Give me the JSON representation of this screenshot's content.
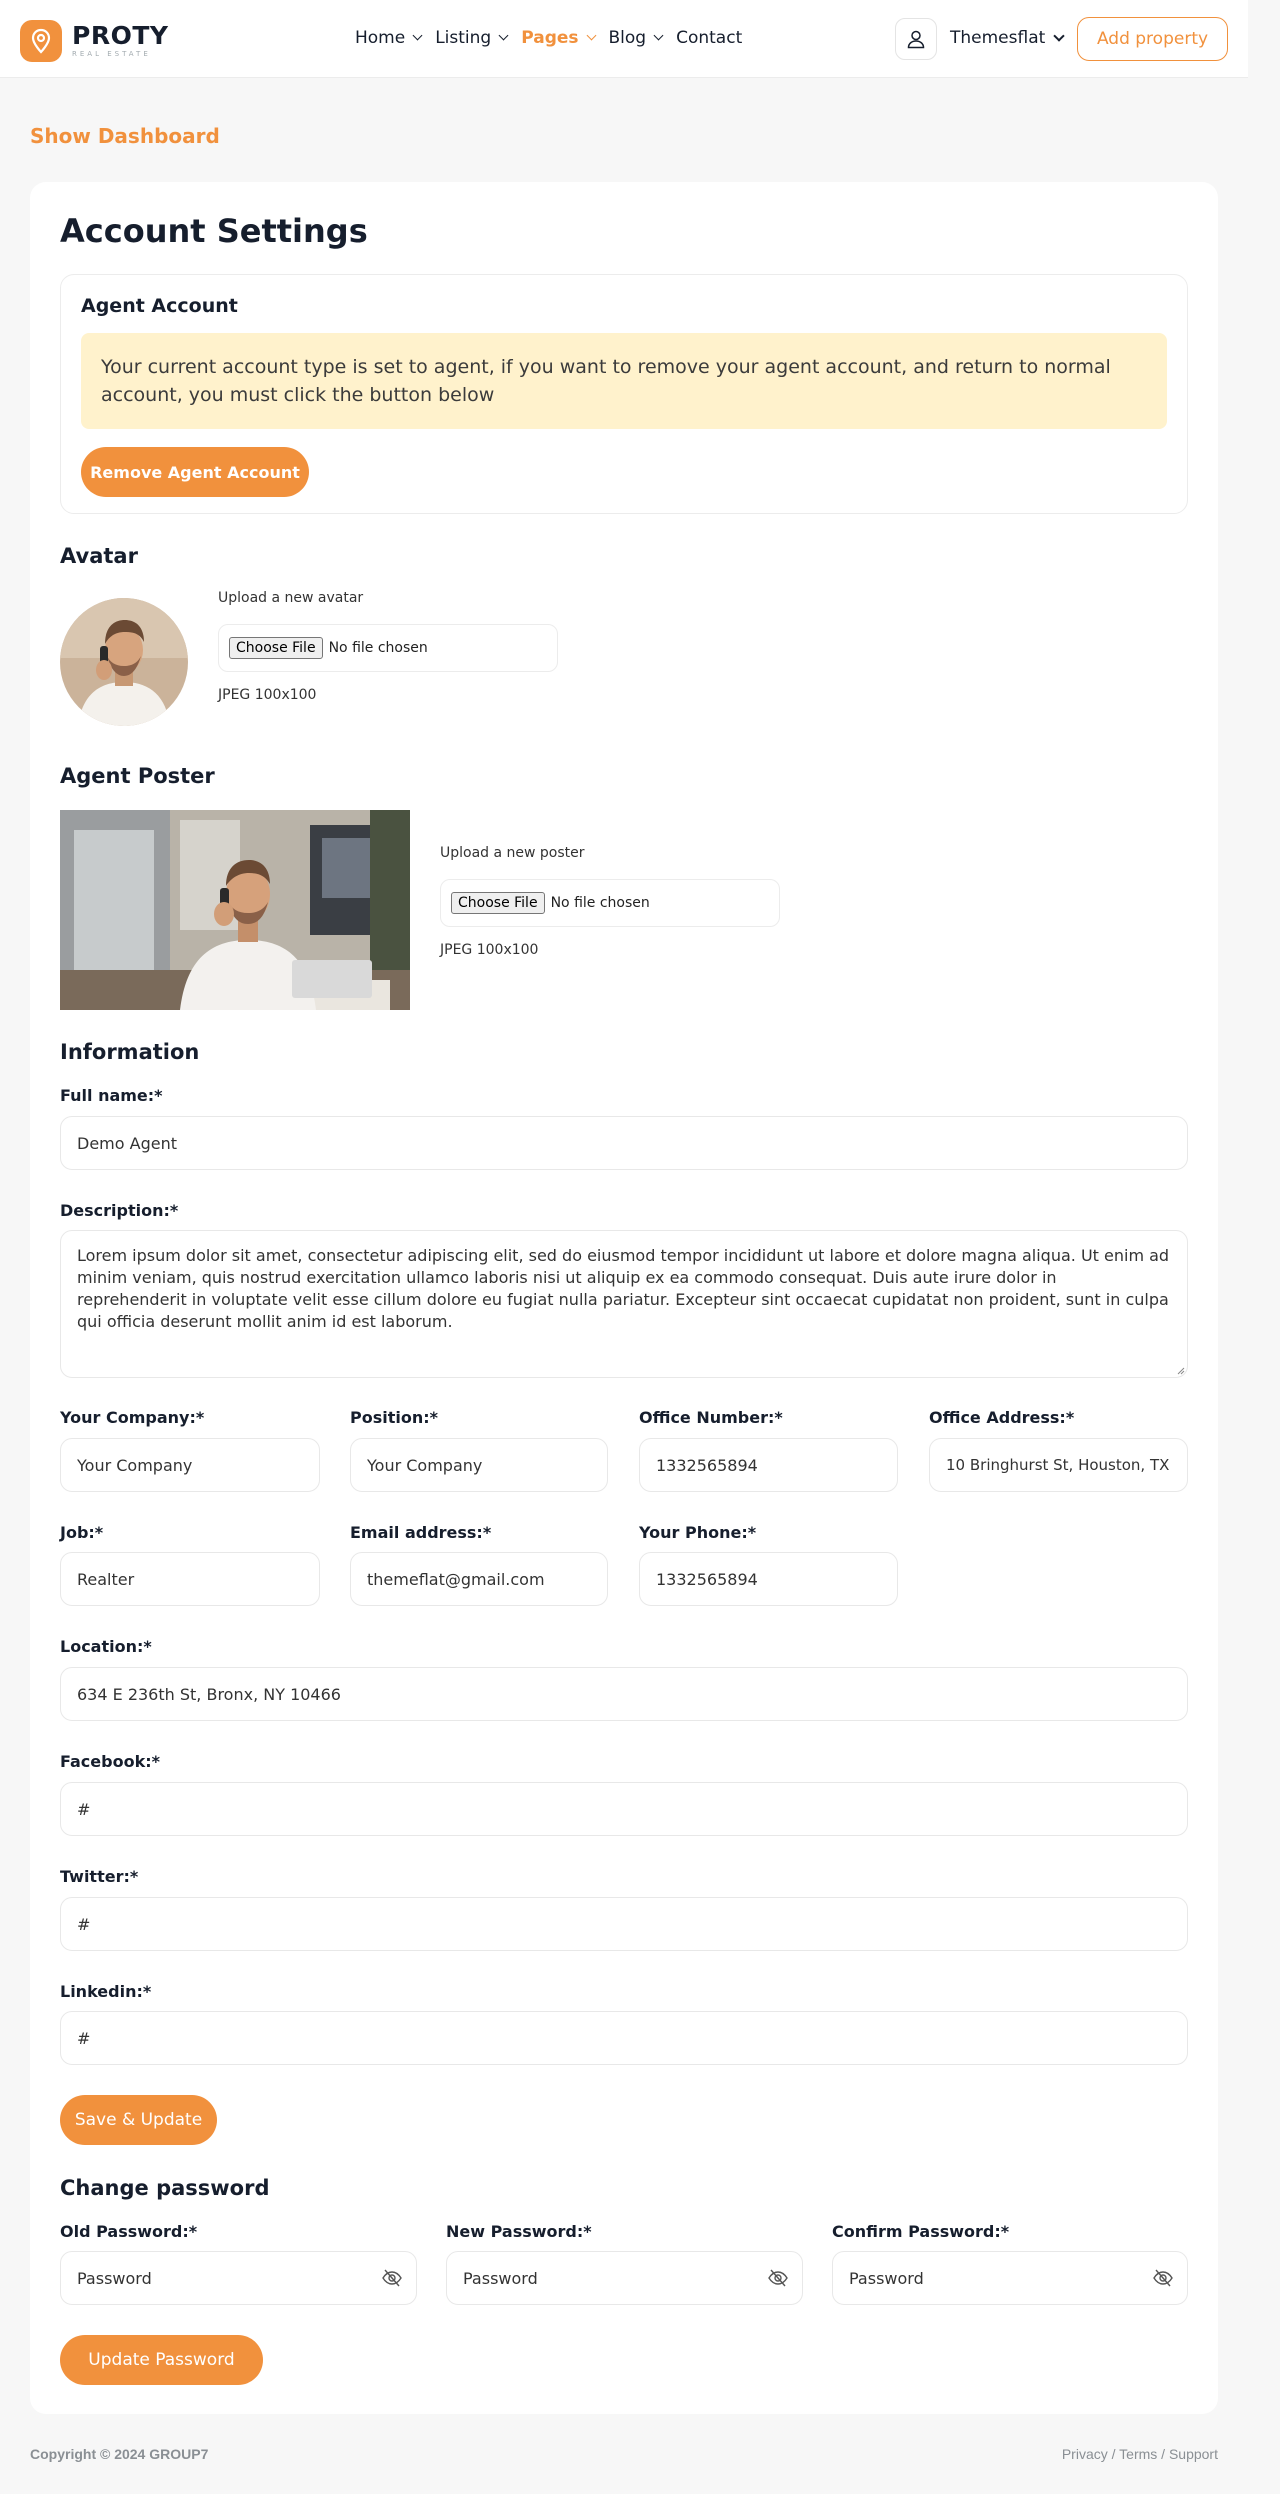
{
  "brand": {
    "name": "PROTY",
    "tagline": "REAL ESTATE"
  },
  "nav": [
    {
      "label": "Home",
      "has_dropdown": true
    },
    {
      "label": "Listing",
      "has_dropdown": true
    },
    {
      "label": "Pages",
      "has_dropdown": true,
      "active": true
    },
    {
      "label": "Blog",
      "has_dropdown": true
    },
    {
      "label": "Contact",
      "has_dropdown": false
    }
  ],
  "user": {
    "name": "Themesflat",
    "icon": "user-icon"
  },
  "add_property_label": "Add property",
  "show_dashboard": "Show Dashboard",
  "page_title": "Account Settings",
  "agent_account": {
    "title": "Agent Account",
    "notice": "Your current account type is set to agent, if you want to remove your agent account, and return to normal account, you must click the button below",
    "remove_button": "Remove Agent Account"
  },
  "avatar": {
    "title": "Avatar",
    "upload_label": "Upload a new avatar",
    "file_button": "Choose File",
    "file_status": "No file chosen",
    "hint": "JPEG 100x100"
  },
  "poster": {
    "title": "Agent Poster",
    "upload_label": "Upload a new poster",
    "file_button": "Choose File",
    "file_status": "No file chosen",
    "hint": "JPEG 100x100"
  },
  "information": {
    "title": "Information",
    "full_name": {
      "label": "Full name:*",
      "value": "Demo Agent"
    },
    "description": {
      "label": "Description:*",
      "value": "Lorem ipsum dolor sit amet, consectetur adipiscing elit, sed do eiusmod tempor incididunt ut labore et dolore magna aliqua. Ut enim ad minim veniam, quis nostrud exercitation ullamco laboris nisi ut aliquip ex ea commodo consequat. Duis aute irure dolor in reprehenderit in voluptate velit esse cillum dolore eu fugiat nulla pariatur. Excepteur sint occaecat cupidatat non proident, sunt in culpa qui officia deserunt mollit anim id est laborum."
    },
    "company": {
      "label": "Your Company:*",
      "value": "Your Company"
    },
    "position": {
      "label": "Position:*",
      "value": "Your Company"
    },
    "office_number": {
      "label": "Office Number:*",
      "value": "1332565894"
    },
    "office_address": {
      "label": "Office Address:*",
      "value": "10 Bringhurst St, Houston, TX"
    },
    "job": {
      "label": "Job:*",
      "value": "Realter"
    },
    "email": {
      "label": "Email address:*",
      "value": "themeflat@gmail.com"
    },
    "phone": {
      "label": "Your Phone:*",
      "value": "1332565894"
    },
    "location": {
      "label": "Location:*",
      "value": "634 E 236th St, Bronx, NY 10466"
    },
    "facebook": {
      "label": "Facebook:*",
      "value": "#"
    },
    "twitter": {
      "label": "Twitter:*",
      "value": "#"
    },
    "linkedin": {
      "label": "Linkedin:*",
      "value": "#"
    },
    "save_button": "Save & Update"
  },
  "password": {
    "title": "Change password",
    "old": {
      "label": "Old Password:*",
      "placeholder": "Password"
    },
    "new": {
      "label": "New Password:*",
      "placeholder": "Password"
    },
    "confirm": {
      "label": "Confirm Password:*",
      "placeholder": "Password"
    },
    "update_button": "Update Password"
  },
  "footer": {
    "copyright": "Copyright © 2024 GROUP7",
    "links": [
      "Privacy",
      "Terms",
      "Support"
    ]
  },
  "colors": {
    "accent": "#f1913d",
    "notice_bg": "#fff2cc",
    "text": "#161e2d"
  }
}
